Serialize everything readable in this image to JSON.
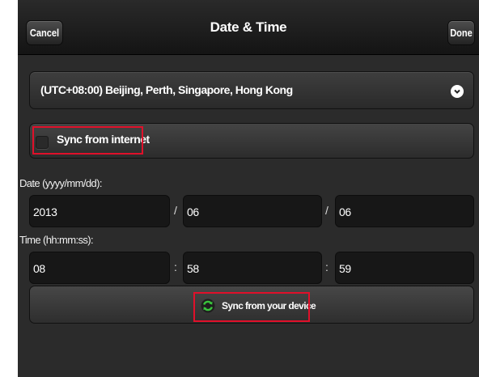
{
  "header": {
    "cancel_label": "Cancel",
    "title": "Date & Time",
    "done_label": "Done"
  },
  "timezone": {
    "selected": "(UTC+08:00) Beijing, Perth, Singapore, Hong Kong"
  },
  "sync_internet": {
    "label": "Sync from internet",
    "checked": false
  },
  "date": {
    "label": "Date (yyyy/mm/dd):",
    "separator": "/",
    "year": "2013",
    "month": "06",
    "day": "06"
  },
  "time": {
    "label": "Time (hh:mm:ss):",
    "separator": ":",
    "hour": "08",
    "minute": "58",
    "second": "59"
  },
  "sync_device": {
    "label": "Sync from your device",
    "icon": "refresh-icon"
  },
  "colors": {
    "highlight": "#e0102a",
    "background": "#2b2b2b",
    "icon_green": "#39c43c"
  }
}
